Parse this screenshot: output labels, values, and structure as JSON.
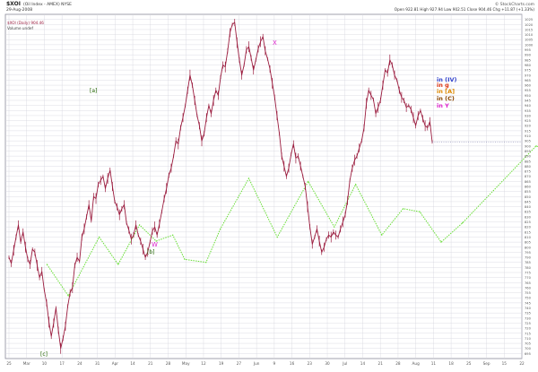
{
  "header": {
    "symbol": "$XOI",
    "index_name": "(Oil Index - AMEX) NYSE",
    "date": "29-Aug-2008",
    "quote": "Open 922.81   High 927.94   Low 902.51   Close 904.46   Chg +11.87 (+1.33%)",
    "watermark": "© StockCharts.com",
    "legend_price": "$XOI (Daily) 904.46",
    "legend_volume": "Volume undef"
  },
  "colors": {
    "price": "#9b1d3f",
    "wave": "#66dd33",
    "grid": "#d4d4dd",
    "axis_text": "#555555",
    "label_blue": "#3344cc",
    "label_red": "#dd3311",
    "label_orange": "#dd8800",
    "label_brown": "#884400",
    "label_magenta": "#dd22cc",
    "wave_label": "#226600"
  },
  "chart_data": {
    "type": "line",
    "title": "$XOI",
    "xlabel": "",
    "ylabel": "",
    "x_ticks": [
      "25",
      "Mar",
      "10",
      "17",
      "24",
      "31",
      "Apr",
      "14",
      "21",
      "28",
      "May",
      "12",
      "19",
      "27",
      "Jun",
      "9",
      "16",
      "23",
      "30",
      "Jul",
      "14",
      "21",
      "28",
      "Aug",
      "11",
      "18",
      "25",
      "Sep",
      "15",
      "22"
    ],
    "ylim": [
      690,
      1030
    ],
    "y_ticks": [
      695,
      700,
      705,
      710,
      715,
      720,
      725,
      730,
      735,
      740,
      745,
      750,
      755,
      760,
      765,
      770,
      775,
      780,
      785,
      790,
      795,
      800,
      805,
      810,
      815,
      820,
      825,
      830,
      835,
      840,
      845,
      850,
      855,
      860,
      865,
      870,
      875,
      880,
      885,
      890,
      895,
      900,
      905,
      910,
      915,
      920,
      925,
      930,
      935,
      940,
      945,
      950,
      955,
      960,
      965,
      970,
      975,
      980,
      985,
      990,
      995,
      1000,
      1005,
      1010,
      1015,
      1020,
      1025
    ],
    "series": [
      {
        "values": [
          790,
          784,
          797,
          810,
          822,
          805,
          815,
          800,
          788,
          783,
          798,
          795,
          782,
          770,
          776,
          758,
          745,
          726,
          712,
          725,
          740,
          718,
          700,
          710,
          722,
          742,
          755,
          760,
          782,
          790,
          786,
          810,
          818,
          830,
          842,
          826,
          850,
          848,
          862,
          866,
          870,
          858,
          868,
          876,
          860,
          845,
          840,
          832,
          838,
          842,
          824,
          817,
          808,
          812,
          822,
          812,
          806,
          798,
          790,
          795,
          805,
          816,
          820,
          812,
          823,
          835,
          848,
          858,
          871,
          878,
          890,
          905,
          902,
          918,
          928,
          940,
          955,
          970,
          960,
          945,
          930,
          920,
          905,
          912,
          928,
          940,
          932,
          945,
          955,
          950,
          968,
          980,
          978,
          994,
          1012,
          1020,
          1022,
          1002,
          985,
          970,
          980,
          995,
          998,
          987,
          975,
          985,
          996,
          1003,
          1008,
          994,
          986,
          976,
          962,
          948,
          930,
          912,
          890,
          880,
          870,
          878,
          892,
          902,
          888,
          890,
          880,
          870,
          860,
          840,
          820,
          803,
          810,
          818,
          806,
          795,
          800,
          808,
          812,
          810,
          815,
          812,
          810,
          818,
          825,
          832,
          846,
          866,
          878,
          886,
          890,
          898,
          905,
          918,
          942,
          955,
          950,
          946,
          932,
          938,
          945,
          960,
          975,
          972,
          985,
          980,
          970,
          965,
          955,
          948,
          945,
          938,
          940,
          936,
          928,
          920,
          930,
          935,
          927,
          920,
          918,
          924,
          904
        ]
      }
    ],
    "wave_path": [
      {
        "x": 16,
        "y": 783
      },
      {
        "x": 25,
        "y": 752
      },
      {
        "x": 38,
        "y": 810
      },
      {
        "x": 46,
        "y": 783
      },
      {
        "x": 55,
        "y": 822
      },
      {
        "x": 62,
        "y": 806
      },
      {
        "x": 69,
        "y": 812
      },
      {
        "x": 74,
        "y": 788
      },
      {
        "x": 83,
        "y": 785
      },
      {
        "x": 89,
        "y": 818
      },
      {
        "x": 101,
        "y": 868
      },
      {
        "x": 113,
        "y": 810
      },
      {
        "x": 126,
        "y": 865
      },
      {
        "x": 137,
        "y": 820
      },
      {
        "x": 146,
        "y": 862
      },
      {
        "x": 157,
        "y": 812
      },
      {
        "x": 166,
        "y": 838
      },
      {
        "x": 173,
        "y": 835
      },
      {
        "x": 182,
        "y": 805
      },
      {
        "x": 191,
        "y": 824
      },
      {
        "x": 222,
        "y": 900
      },
      {
        "x": 233,
        "y": 890
      },
      {
        "x": 246,
        "y": 930
      },
      {
        "x": 256,
        "y": 925
      },
      {
        "x": 270,
        "y": 992
      },
      {
        "x": 282,
        "y": 984
      },
      {
        "x": 294,
        "y": 958
      },
      {
        "x": 306,
        "y": 1004
      },
      {
        "x": 315,
        "y": 940
      },
      {
        "x": 325,
        "y": 928
      },
      {
        "x": 336,
        "y": 952
      },
      {
        "x": 344,
        "y": 938
      },
      {
        "x": 354,
        "y": 940
      },
      {
        "x": 364,
        "y": 920
      },
      {
        "x": 376,
        "y": 912
      },
      {
        "x": 384,
        "y": 914
      },
      {
        "x": 394,
        "y": 930
      }
    ],
    "wave_label_text": [
      "[a]",
      "[b]",
      "[c]"
    ],
    "annotations": [
      "X",
      "W",
      "in (IV)",
      "in g",
      "in [A]",
      "in (C)",
      "in Y"
    ]
  }
}
